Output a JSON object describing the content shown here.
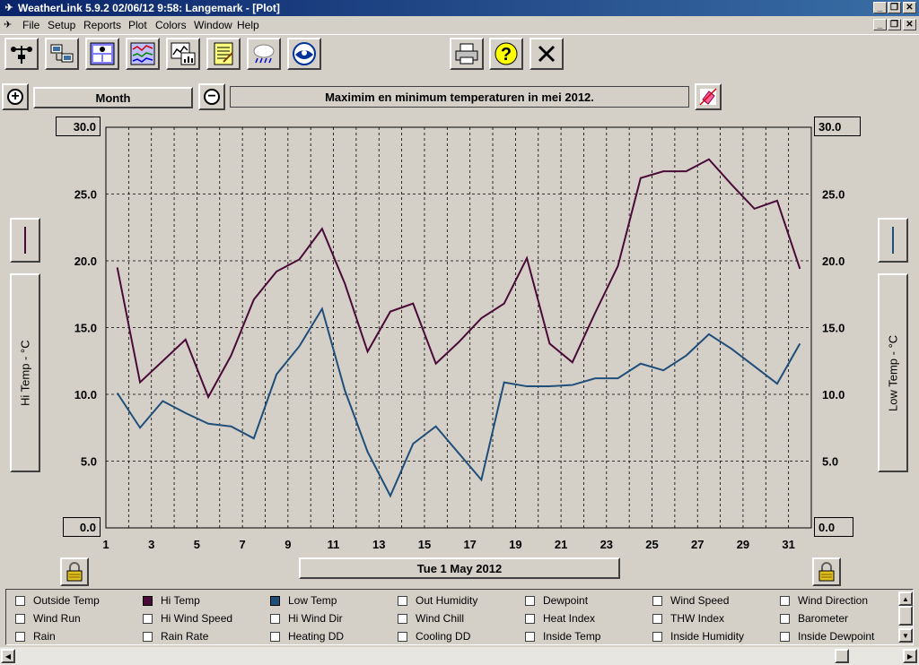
{
  "window": {
    "title": "WeatherLink 5.9.2  02/06/12   9:58: Langemark - [Plot]"
  },
  "menu": [
    "File",
    "Setup",
    "Reports",
    "Plot",
    "Colors",
    "Window",
    "Help"
  ],
  "toolbar": {
    "icons": [
      "weather-station-icon",
      "download-icon",
      "bulletin-icon",
      "strip-chart-icon",
      "plot-icon",
      "browse-icon",
      "summary-icon",
      "noaa-icon",
      "print-icon",
      "help-icon",
      "close-icon"
    ]
  },
  "plot_controls": {
    "period": "Month",
    "title": "Maximim en minimum temperaturen in mei 2012.",
    "cursor_date": "Tue 1 May 2012"
  },
  "axes": {
    "left_label": "Hi Temp - °C",
    "right_label": "Low Temp - °C",
    "left_max": "30.0",
    "left_min": "0.0",
    "right_max": "30.0",
    "right_min": "0.0"
  },
  "colors": {
    "hi_temp": "#4a0a38",
    "low_temp": "#1f4e79"
  },
  "chart_data": {
    "type": "line",
    "x": [
      1,
      2,
      3,
      4,
      5,
      6,
      7,
      8,
      9,
      10,
      11,
      12,
      13,
      14,
      15,
      16,
      17,
      18,
      19,
      20,
      21,
      22,
      23,
      24,
      25,
      26,
      27,
      28,
      29,
      30,
      31
    ],
    "xticks": [
      "1",
      "3",
      "5",
      "7",
      "9",
      "11",
      "13",
      "15",
      "17",
      "19",
      "21",
      "23",
      "25",
      "27",
      "29",
      "31"
    ],
    "yticks": [
      "5.0",
      "10.0",
      "15.0",
      "20.0",
      "25.0"
    ],
    "xlim": [
      1,
      32
    ],
    "ylim": [
      0,
      30
    ],
    "grid": true,
    "series": [
      {
        "name": "Hi Temp",
        "color": "#4a0a38",
        "values": [
          19.5,
          10.9,
          12.5,
          14.1,
          9.8,
          12.9,
          17.1,
          19.2,
          20.1,
          22.4,
          18.3,
          13.2,
          16.2,
          16.8,
          12.3,
          13.9,
          15.7,
          16.8,
          20.2,
          13.8,
          12.4,
          16.1,
          19.6,
          26.2,
          26.7,
          26.7,
          27.6,
          25.7,
          23.9,
          24.5,
          19.4
        ]
      },
      {
        "name": "Low Temp",
        "color": "#1f4e79",
        "values": [
          10.1,
          7.5,
          9.5,
          8.6,
          7.8,
          7.6,
          6.7,
          11.5,
          13.6,
          16.4,
          10.3,
          5.7,
          2.4,
          6.3,
          7.6,
          5.6,
          3.6,
          10.9,
          10.6,
          10.6,
          10.7,
          11.2,
          11.2,
          12.3,
          11.8,
          12.9,
          14.5,
          13.4,
          12.1,
          10.8,
          13.8
        ]
      }
    ]
  },
  "legend": [
    {
      "label": "Outside Temp",
      "checked": false,
      "color": null
    },
    {
      "label": "Hi Temp",
      "checked": true,
      "color": "#4a0a38"
    },
    {
      "label": "Low Temp",
      "checked": true,
      "color": "#1f4e79"
    },
    {
      "label": "Out Humidity",
      "checked": false,
      "color": null
    },
    {
      "label": "Dewpoint",
      "checked": false,
      "color": null
    },
    {
      "label": "Wind Speed",
      "checked": false,
      "color": null
    },
    {
      "label": "Wind Direction",
      "checked": false,
      "color": null
    },
    {
      "label": "Wind Run",
      "checked": false,
      "color": null
    },
    {
      "label": "Hi Wind Speed",
      "checked": false,
      "color": null
    },
    {
      "label": "Hi Wind Dir",
      "checked": false,
      "color": null
    },
    {
      "label": "Wind Chill",
      "checked": false,
      "color": null
    },
    {
      "label": "Heat Index",
      "checked": false,
      "color": null
    },
    {
      "label": "THW Index",
      "checked": false,
      "color": null
    },
    {
      "label": "Barometer",
      "checked": false,
      "color": null
    },
    {
      "label": "Rain",
      "checked": false,
      "color": null
    },
    {
      "label": "Rain Rate",
      "checked": false,
      "color": null
    },
    {
      "label": "Heating DD",
      "checked": false,
      "color": null
    },
    {
      "label": "Cooling DD",
      "checked": false,
      "color": null
    },
    {
      "label": "Inside Temp",
      "checked": false,
      "color": null
    },
    {
      "label": "Inside Humidity",
      "checked": false,
      "color": null
    },
    {
      "label": "Inside Dewpoint",
      "checked": false,
      "color": null
    }
  ]
}
